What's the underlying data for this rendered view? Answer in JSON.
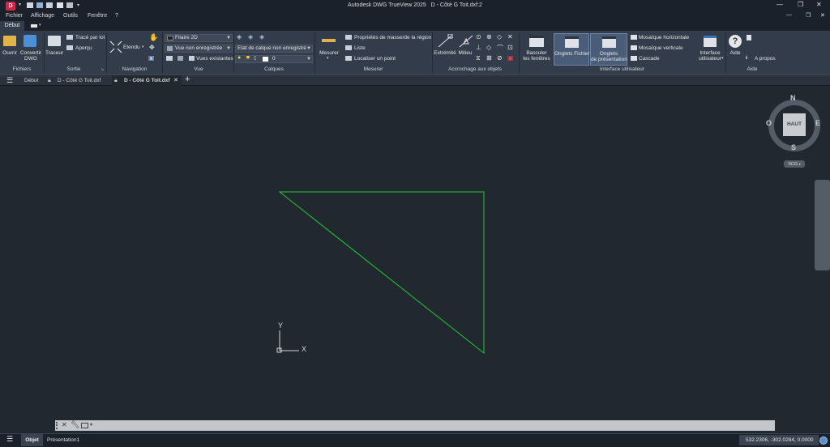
{
  "app": {
    "title": "Autodesk DWG TrueView 2025",
    "document": "D - Côté G Toit.dxf:2",
    "logo_letter": "D"
  },
  "menu": [
    "Fichier",
    "Affichage",
    "Outils",
    "Fenêtre",
    "?"
  ],
  "ribbon_tab": "Début",
  "panels": {
    "fichiers": {
      "title": "Fichiers",
      "ouvrir": "Ouvrir",
      "convertir": "Convertir\nDWG"
    },
    "sortie": {
      "title": "Sortie",
      "traceur": "Traceur",
      "trace_lot": "Tracé par lot",
      "apercu": "Aperçu"
    },
    "navigation": {
      "title": "Navigation",
      "etendu": "Etendu"
    },
    "vue": {
      "title": "Vue",
      "style": "Filaire 2D",
      "vue_nom": "Vue non enregistrée",
      "vues_existantes": "Vues existantes"
    },
    "calques": {
      "title": "Calques",
      "etat": "Etat de calque non enregistré",
      "calque": "0"
    },
    "mesurer": {
      "title": "Mesurer",
      "mesurer": "Mesurer",
      "proprietes": "Propriétés de masse/de la région",
      "liste": "Liste",
      "localiser": "Localiser un point"
    },
    "accrochage": {
      "title": "Accrochage aux objets",
      "extremite": "Extrémité",
      "milieu": "Milieu"
    },
    "interface": {
      "title": "Interface utilisateur",
      "basculer": "Basculer\nles fenêtres",
      "onglets_fichier": "Onglets Fichier",
      "onglets_presentation": "Onglets\nde présentation",
      "mosaique_h": "Mosaïque horizontale",
      "mosaique_v": "Mosaïque verticale",
      "cascade": "Cascade",
      "interface_util": "Interface\nutilisateur"
    },
    "aide": {
      "title": "Aide",
      "aide": "Aide",
      "a_propos": "A propos"
    }
  },
  "doc_tabs": [
    {
      "label": "Début"
    },
    {
      "label": "D - Côté G Toit.dxf"
    },
    {
      "label": "D - Côté G Toit.dxf"
    }
  ],
  "viewcube": {
    "top": "HAUT",
    "n": "N",
    "s": "S",
    "e": "E",
    "w": "O",
    "wcs": "SCG"
  },
  "ucs": {
    "x": "X",
    "y": "Y"
  },
  "layout_tabs": [
    "Objet",
    "Présentation1"
  ],
  "coords": "532.2306, -302.0284, 0.0000",
  "colors": {
    "drawing_line": "#22c832",
    "canvas": "#212830",
    "ribbon": "#323c4a"
  }
}
